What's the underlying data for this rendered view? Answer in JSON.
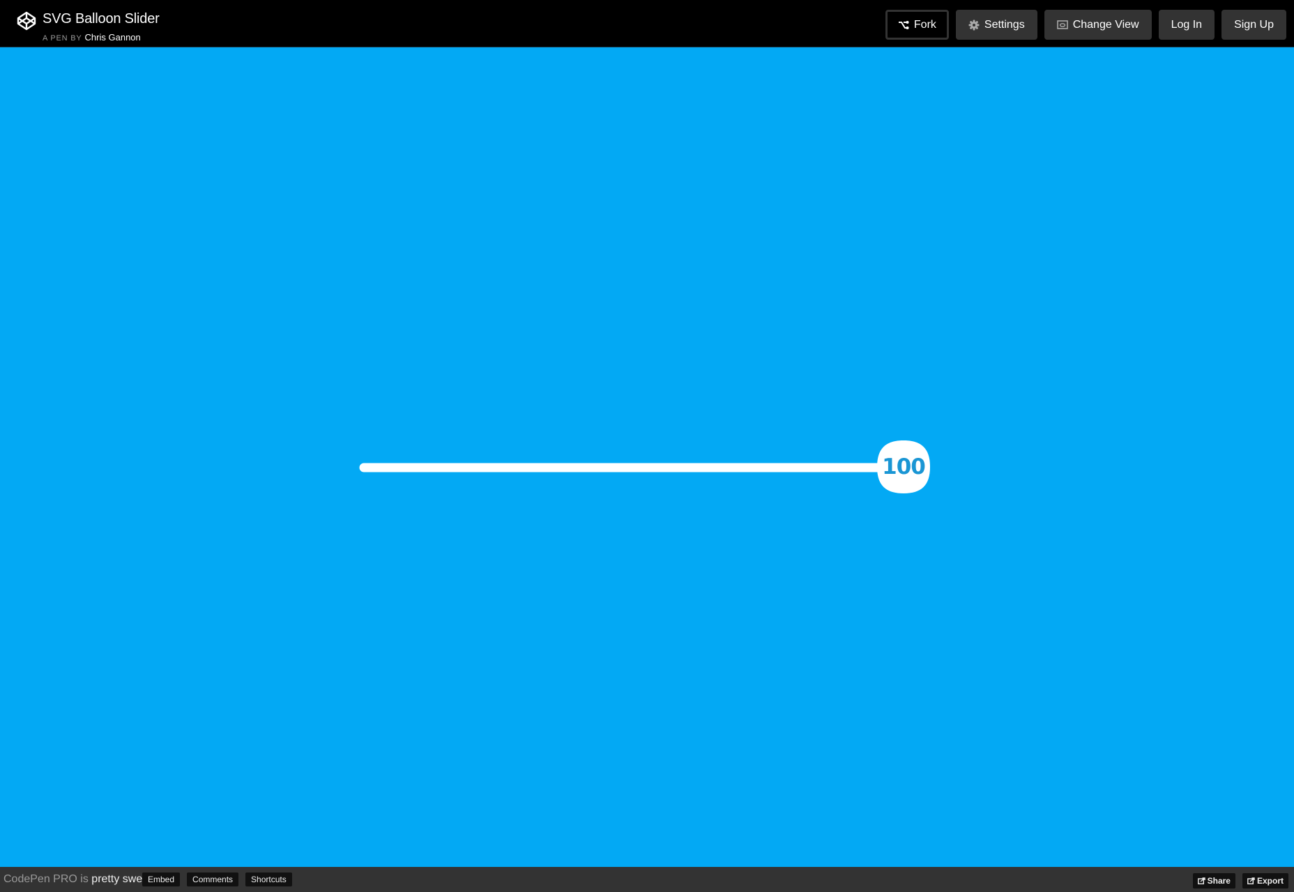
{
  "header": {
    "title": "SVG Balloon Slider",
    "byline_prefix": "A PEN BY",
    "author": "Chris Gannon",
    "logo_icon": "codepen-logo-icon",
    "buttons": [
      {
        "label": "Fork",
        "icon": "fork-icon"
      },
      {
        "label": "Settings",
        "icon": "gear-icon"
      },
      {
        "label": "Change View",
        "icon": "change-view-icon"
      },
      {
        "label": "Log In"
      },
      {
        "label": "Sign Up"
      }
    ]
  },
  "stage": {
    "background": "#03a9f4",
    "slider": {
      "value": 100,
      "display_value": "100",
      "min": 0,
      "max": 100,
      "track_color": "#ffffff",
      "value_color": "#1a96d4"
    }
  },
  "footer": {
    "promo_prefix": "CodePen PRO is",
    "promo_strong": "pretty sweet.",
    "buttons": [
      "Embed",
      "Comments",
      "Shortcuts"
    ],
    "right_buttons": [
      {
        "label": "Share",
        "icon": "share-icon"
      },
      {
        "label": "Export",
        "icon": "export-icon"
      }
    ]
  }
}
